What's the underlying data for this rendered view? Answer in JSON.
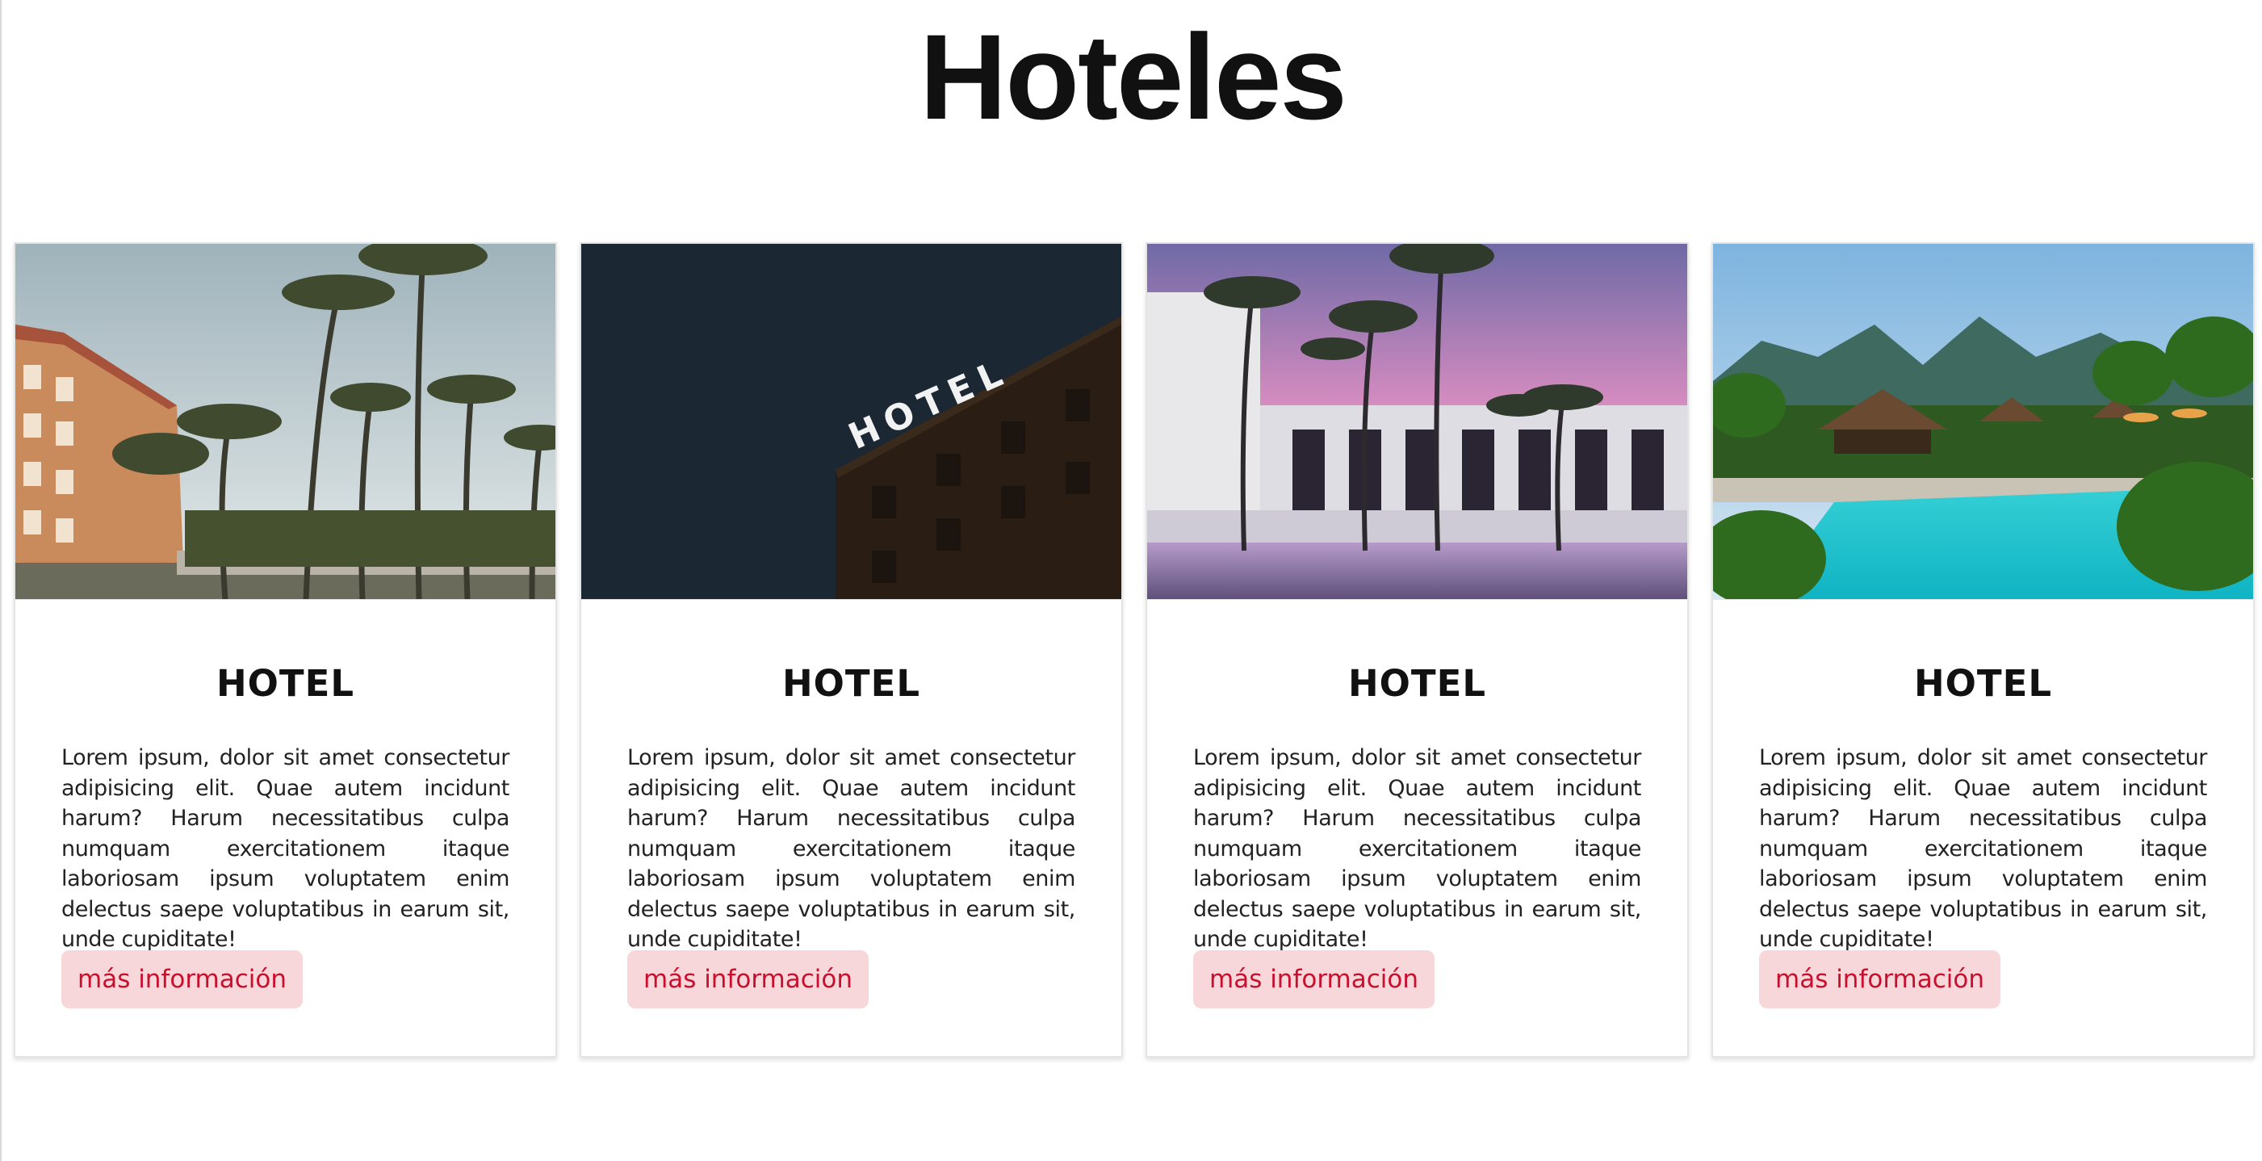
{
  "page": {
    "title": "Hoteles"
  },
  "cards": [
    {
      "image": "palm-resort-photo",
      "title": "HOTEL",
      "text": "Lorem ipsum, dolor sit amet consectetur adipisicing elit. Quae autem incidunt harum? Harum necessitatibus culpa numquam exercitationem itaque laboriosam ipsum voluptatem enim delectus saepe voluptatibus in earum sit, unde cupiditate!",
      "button": "más información"
    },
    {
      "image": "hotel-sign-night-photo",
      "title": "HOTEL",
      "text": "Lorem ipsum, dolor sit amet consectetur adipisicing elit. Quae autem incidunt harum? Harum necessitatibus culpa numquam exercitationem itaque laboriosam ipsum voluptatem enim delectus saepe voluptatibus in earum sit, unde cupiditate!",
      "button": "más información",
      "sign_text": "HOTEL"
    },
    {
      "image": "pool-sunset-photo",
      "title": "HOTEL",
      "text": "Lorem ipsum, dolor sit amet consectetur adipisicing elit. Quae autem incidunt harum? Harum necessitatibus culpa numquam exercitationem itaque laboriosam ipsum voluptatem enim delectus saepe voluptatibus in earum sit, unde cupiditate!",
      "button": "más información"
    },
    {
      "image": "tropical-pool-photo",
      "title": "HOTEL",
      "text": "Lorem ipsum, dolor sit amet consectetur adipisicing elit. Quae autem incidunt harum? Harum necessitatibus culpa numquam exercitationem itaque laboriosam ipsum voluptatem enim delectus saepe voluptatibus in earum sit, unde cupiditate!",
      "button": "más información"
    }
  ],
  "colors": {
    "button_bg": "#f8d7da",
    "button_text": "#c8102e",
    "title": "#111111"
  }
}
